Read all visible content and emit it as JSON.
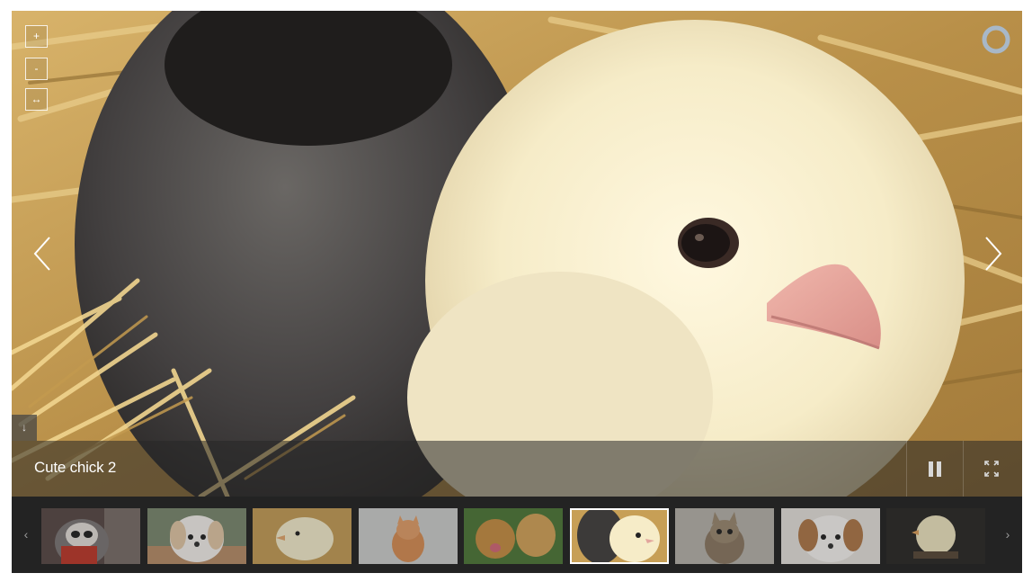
{
  "gallery": {
    "caption": "Cute chick 2",
    "zoom": {
      "in_label": "+",
      "out_label": "-",
      "reset_label": "↔"
    },
    "download_label": "↓",
    "strip_prev_label": "‹",
    "strip_next_label": "›",
    "active_thumbnail": 6,
    "thumbnails": [
      {
        "name": "thumb-1",
        "subject": "raccoon toy"
      },
      {
        "name": "thumb-2",
        "subject": "white puppy"
      },
      {
        "name": "thumb-3",
        "subject": "yellow chick"
      },
      {
        "name": "thumb-4",
        "subject": "orange kitten"
      },
      {
        "name": "thumb-5",
        "subject": "golden puppies"
      },
      {
        "name": "thumb-6",
        "subject": "two chicks"
      },
      {
        "name": "thumb-7",
        "subject": "tabby kitten"
      },
      {
        "name": "thumb-8",
        "subject": "puppy"
      },
      {
        "name": "thumb-9",
        "subject": "chick on branch"
      }
    ]
  },
  "colors": {
    "straw": "#c9a255",
    "chick_yellow": "#f3e9c6",
    "dark_chick": "#3d3a38",
    "strip_bg": "#232323"
  }
}
